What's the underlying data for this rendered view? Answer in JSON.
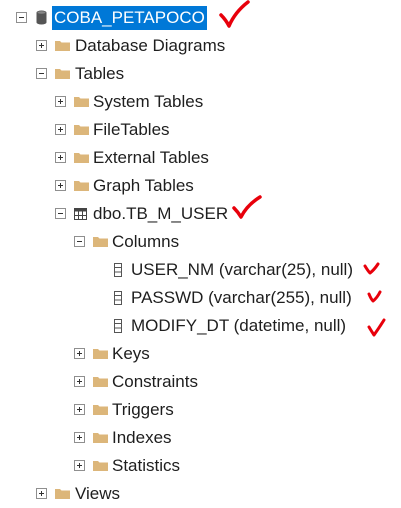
{
  "tree": {
    "database": "COBA_PETAPOCO",
    "database_diagrams": "Database Diagrams",
    "tables": "Tables",
    "system_tables": "System Tables",
    "file_tables": "FileTables",
    "external_tables": "External Tables",
    "graph_tables": "Graph Tables",
    "table_name": "dbo.TB_M_USER",
    "columns": "Columns",
    "column_items": [
      "USER_NM (varchar(25), null)",
      "PASSWD (varchar(255), null)",
      "MODIFY_DT (datetime, null)"
    ],
    "keys": "Keys",
    "constraints": "Constraints",
    "triggers": "Triggers",
    "indexes": "Indexes",
    "statistics": "Statistics",
    "views": "Views"
  },
  "colors": {
    "selection": "#0078d7",
    "folder": "#dcb67a",
    "annotation": "#e8000b"
  }
}
